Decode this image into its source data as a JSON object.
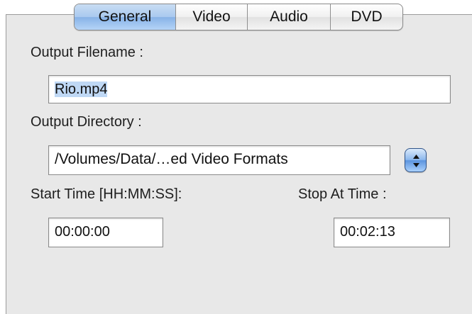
{
  "tabs": [
    {
      "label": "General",
      "active": true
    },
    {
      "label": "Video",
      "active": false
    },
    {
      "label": "Audio",
      "active": false
    },
    {
      "label": "DVD",
      "active": false
    }
  ],
  "output_filename": {
    "label": "Output Filename :",
    "value": "Rio.mp4"
  },
  "output_directory": {
    "label": "Output Directory :",
    "value": "/Volumes/Data/…ed Video Formats",
    "stepper_icon": "up-down-stepper-icon"
  },
  "start_time": {
    "label": "Start Time [HH:MM:SS]:",
    "value": "00:00:00"
  },
  "stop_time": {
    "label": "Stop At Time :",
    "value": "00:02:13"
  },
  "colors": {
    "panel_background": "#e8e8e8",
    "selected_tab": "#9fc3ef",
    "selection_highlight": "#bfd8f5"
  }
}
